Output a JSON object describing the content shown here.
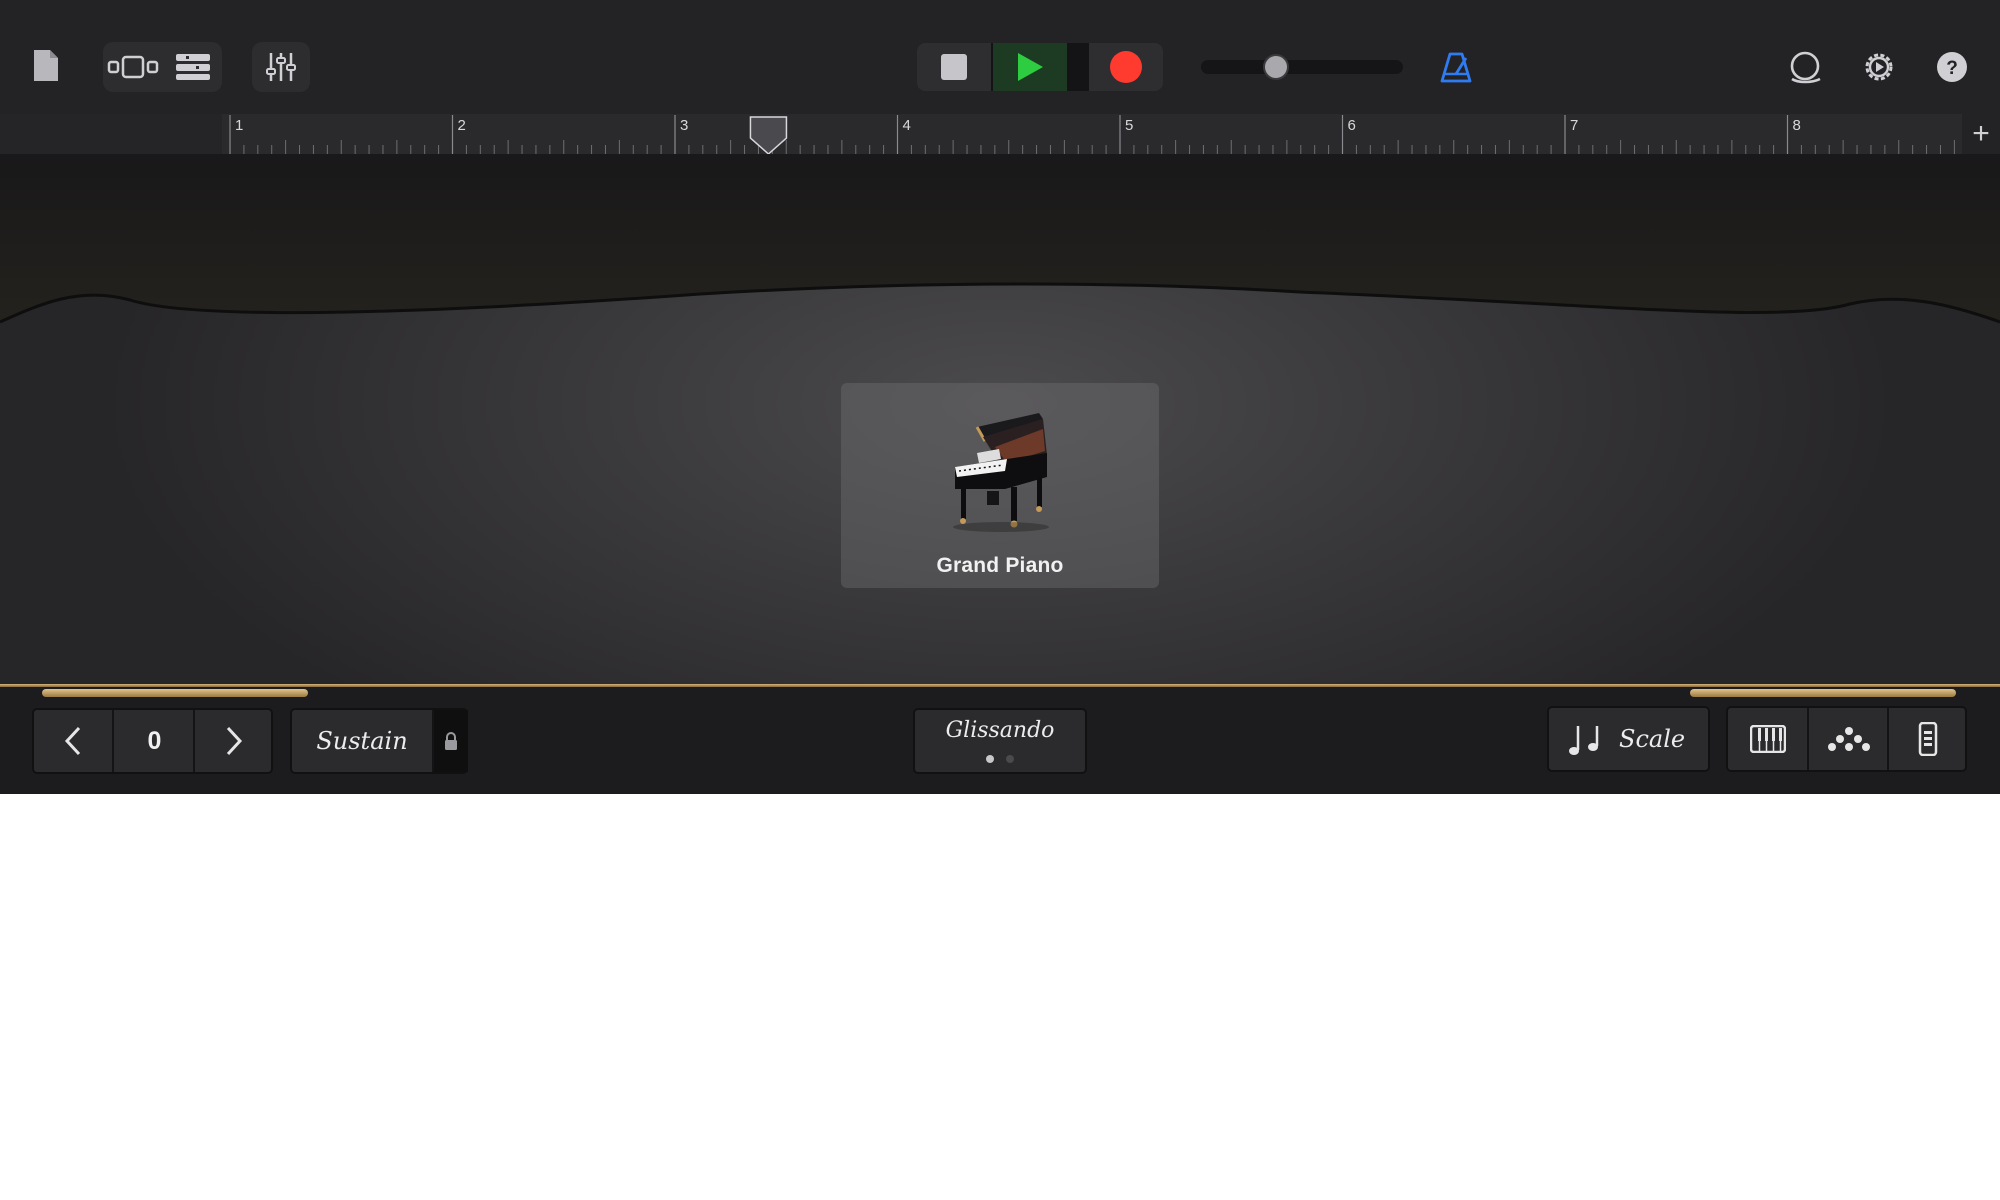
{
  "toolbar": {
    "left_icons": [
      "document-icon",
      "tracks-view-icon",
      "browser-list-icon",
      "mixer-controls-icon"
    ],
    "transport": {
      "stop": "stop-icon",
      "play": "play-icon",
      "record": "record-icon"
    },
    "volume_level": 0.35,
    "right_icons": [
      "metronome-icon",
      "loop-browser-icon",
      "settings-icon",
      "help-icon"
    ],
    "colors": {
      "play": "#2ecc40",
      "record": "#ff3b30",
      "metronome": "#2f7bf2"
    }
  },
  "ruler": {
    "bars": [
      "1",
      "2",
      "3",
      "4",
      "5",
      "6",
      "7",
      "8"
    ],
    "playhead_bar": 3.42,
    "add_label": "+"
  },
  "instrument": {
    "name": "Grand Piano",
    "icon": "grand-piano-image"
  },
  "bottom": {
    "octave_value": "0",
    "sustain_label": "Sustain",
    "glissando_label": "Glissando",
    "glissando_page": 1,
    "glissando_pages": 2,
    "scale_label": "Scale",
    "view_icons": [
      "keyboard-icon",
      "arpeggiator-icon",
      "controller-icon"
    ]
  },
  "colors": {
    "accent_gold": "#d6b37a"
  }
}
